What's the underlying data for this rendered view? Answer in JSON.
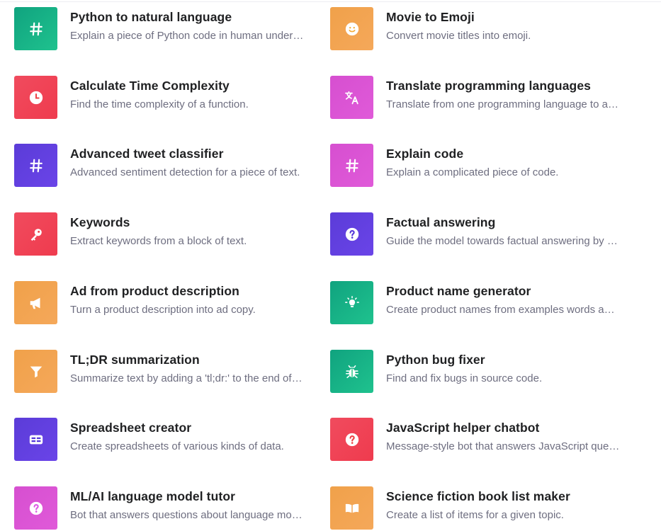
{
  "examples": {
    "left": [
      {
        "title": "Python to natural language",
        "description": "Explain a piece of Python code in human understandable language.",
        "icon": "hash-icon",
        "color": "#19c37d"
      },
      {
        "title": "Calculate Time Complexity",
        "description": "Find the time complexity of a function.",
        "icon": "clock-icon",
        "color": "#ef4146"
      },
      {
        "title": "Advanced tweet classifier",
        "description": "Advanced sentiment detection for a piece of text.",
        "icon": "hash-icon",
        "color": "#5436da"
      },
      {
        "title": "Keywords",
        "description": "Extract keywords from a block of text.",
        "icon": "key-icon",
        "color": "#ef4146"
      },
      {
        "title": "Ad from product description",
        "description": "Turn a product description into ad copy.",
        "icon": "megaphone-icon",
        "color": "#f4ac36"
      },
      {
        "title": "TL;DR summarization",
        "description": "Summarize text by adding a 'tl;dr:' to the end of a text passage.",
        "icon": "funnel-icon",
        "color": "#f4ac36"
      },
      {
        "title": "Spreadsheet creator",
        "description": "Create spreadsheets of various kinds of data.",
        "icon": "table-icon",
        "color": "#5436da"
      },
      {
        "title": "ML/AI language model tutor",
        "description": "Bot that answers questions about language models.",
        "icon": "question-icon",
        "color": "#dd5ce5"
      }
    ],
    "right": [
      {
        "title": "Movie to Emoji",
        "description": "Convert movie titles into emoji.",
        "icon": "smiley-icon",
        "color": "#f4ac36"
      },
      {
        "title": "Translate programming languages",
        "description": "Translate from one programming language to another.",
        "icon": "translate-icon",
        "color": "#dd5ce5"
      },
      {
        "title": "Explain code",
        "description": "Explain a complicated piece of code.",
        "icon": "hash-icon",
        "color": "#dd5ce5"
      },
      {
        "title": "Factual answering",
        "description": "Guide the model towards factual answering by showing it how to respond.",
        "icon": "question-icon",
        "color": "#5436da"
      },
      {
        "title": "Product name generator",
        "description": "Create product names from examples words and descriptions.",
        "icon": "lightbulb-icon",
        "color": "#19c37d"
      },
      {
        "title": "Python bug fixer",
        "description": "Find and fix bugs in source code.",
        "icon": "bug-icon",
        "color": "#19c37d"
      },
      {
        "title": "JavaScript helper chatbot",
        "description": "Message-style bot that answers JavaScript questions.",
        "icon": "question-icon",
        "color": "#ef4146"
      },
      {
        "title": "Science fiction book list maker",
        "description": "Create a list of items for a given topic.",
        "icon": "book-icon",
        "color": "#f4ac36"
      }
    ]
  }
}
